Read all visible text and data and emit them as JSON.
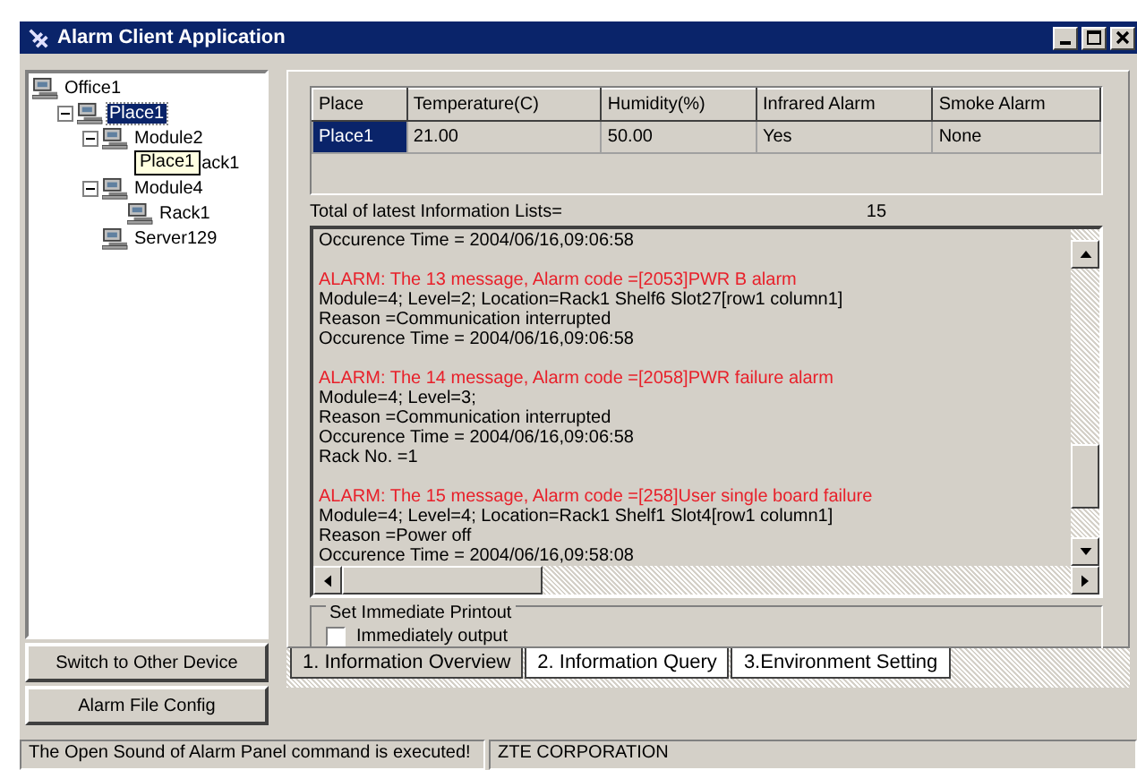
{
  "window": {
    "title": "Alarm Client Application"
  },
  "tree": [
    {
      "label": "Office1",
      "selected": false,
      "children": [
        {
          "label": "Place1",
          "selected": true,
          "expanded": true,
          "children": [
            {
              "label": "Module2",
              "selected": false,
              "expanded": true,
              "children": [
                {
                  "label": "ack1",
                  "selected": false,
                  "tooltip": "Place1"
                }
              ]
            },
            {
              "label": "Module4",
              "selected": false,
              "expanded": true,
              "children": [
                {
                  "label": "Rack1",
                  "selected": false
                }
              ]
            },
            {
              "label": "Server129",
              "selected": false
            }
          ]
        }
      ]
    }
  ],
  "side_buttons": [
    "Switch to Other Device",
    "Alarm File Config"
  ],
  "table": {
    "columns": [
      "Place",
      "Temperature(C)",
      "Humidity(%)",
      "Infrared Alarm",
      "Smoke Alarm"
    ],
    "rows": [
      {
        "selected": true,
        "cells": [
          "Place1",
          "21.00",
          "50.00",
          "Yes",
          "None"
        ]
      }
    ]
  },
  "total": {
    "label": "Total of latest Information Lists=",
    "value": "15"
  },
  "log": [
    [
      {
        "kind": "info",
        "text": "Occurence Time = 2004/06/16,09:06:58"
      }
    ],
    [
      {
        "kind": "alarm",
        "text": "ALARM:  The 13 message, Alarm code =[2053]PWR B alarm"
      },
      {
        "kind": "info",
        "text": "Module=4; Level=2; Location=Rack1 Shelf6 Slot27[row1 column1]"
      },
      {
        "kind": "info",
        "text": "Reason =Communication interrupted"
      },
      {
        "kind": "info",
        "text": "Occurence Time = 2004/06/16,09:06:58"
      }
    ],
    [
      {
        "kind": "alarm",
        "text": "ALARM:  The 14 message, Alarm code =[2058]PWR failure alarm"
      },
      {
        "kind": "info",
        "text": "Module=4; Level=3;"
      },
      {
        "kind": "info",
        "text": "Reason =Communication interrupted"
      },
      {
        "kind": "info",
        "text": "Occurence Time = 2004/06/16,09:06:58"
      },
      {
        "kind": "info",
        "text": "Rack No. =1"
      }
    ],
    [
      {
        "kind": "alarm",
        "text": "ALARM:  The 15 message, Alarm code =[258]User single board failure"
      },
      {
        "kind": "info",
        "text": "Module=4; Level=4; Location=Rack1 Shelf1 Slot4[row1 column1]"
      },
      {
        "kind": "info",
        "text": "Reason =Power off"
      },
      {
        "kind": "info",
        "text": "Occurence Time = 2004/06/16,09:58:08"
      }
    ]
  ],
  "printout": {
    "title": "Set Immediate Printout",
    "option": {
      "label": "Immediately output",
      "checked": false
    }
  },
  "tabs": [
    {
      "label": "1. Information Overview",
      "selected": true
    },
    {
      "label": "2. Information Query",
      "selected": false
    },
    {
      "label": "3.Environment Setting",
      "selected": false
    }
  ],
  "status_bar": [
    "The Open Sound of Alarm Panel command is executed!",
    "ZTE CORPORATION"
  ]
}
